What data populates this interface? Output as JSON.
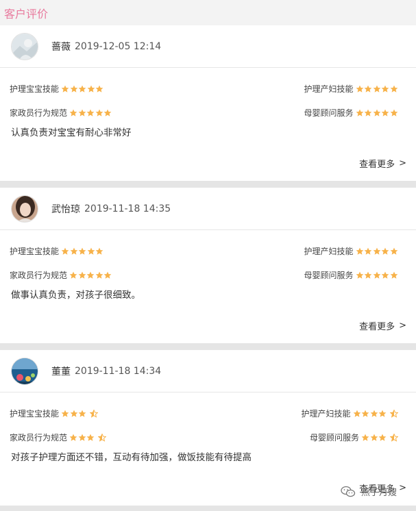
{
  "header": {
    "title": "客户评价"
  },
  "more_label": "查看更多",
  "more_chevron": ">",
  "reviews": [
    {
      "name": "蔷薇",
      "date": "2019-12-05 12:14",
      "avatar_icon": "user-avatar-icon",
      "ratings": [
        {
          "label": "护理宝宝技能",
          "stars": 5
        },
        {
          "label": "护理产妇技能",
          "stars": 5
        },
        {
          "label": "家政员行为规范",
          "stars": 5
        },
        {
          "label": "母婴顾问服务",
          "stars": 5
        }
      ],
      "text": "认真负责对宝宝有耐心非常好"
    },
    {
      "name": "武怡琼",
      "date": "2019-11-18 14:35",
      "avatar_icon": "user-avatar-icon",
      "ratings": [
        {
          "label": "护理宝宝技能",
          "stars": 5
        },
        {
          "label": "护理产妇技能",
          "stars": 5
        },
        {
          "label": "家政员行为规范",
          "stars": 5
        },
        {
          "label": "母婴顾问服务",
          "stars": 5
        }
      ],
      "text": "做事认真负责，对孩子很细致。"
    },
    {
      "name": "董董",
      "date": "2019-11-18 14:34",
      "avatar_icon": "user-avatar-icon",
      "ratings": [
        {
          "label": "护理宝宝技能",
          "stars": 3.5
        },
        {
          "label": "护理产妇技能",
          "stars": 4.5
        },
        {
          "label": "家政员行为规范",
          "stars": 3.5
        },
        {
          "label": "母婴顾问服务",
          "stars": 3.5
        }
      ],
      "text": "对孩子护理方面还不错，互动有待加强，做饭技能有待提高"
    }
  ],
  "watermark": {
    "text": "燕子月嫂",
    "icon": "wechat-icon"
  },
  "colors": {
    "accent": "#e8799d",
    "star": "#f7b24a",
    "divider": "#e5e5e5",
    "header_bg": "#f3f3f3"
  }
}
